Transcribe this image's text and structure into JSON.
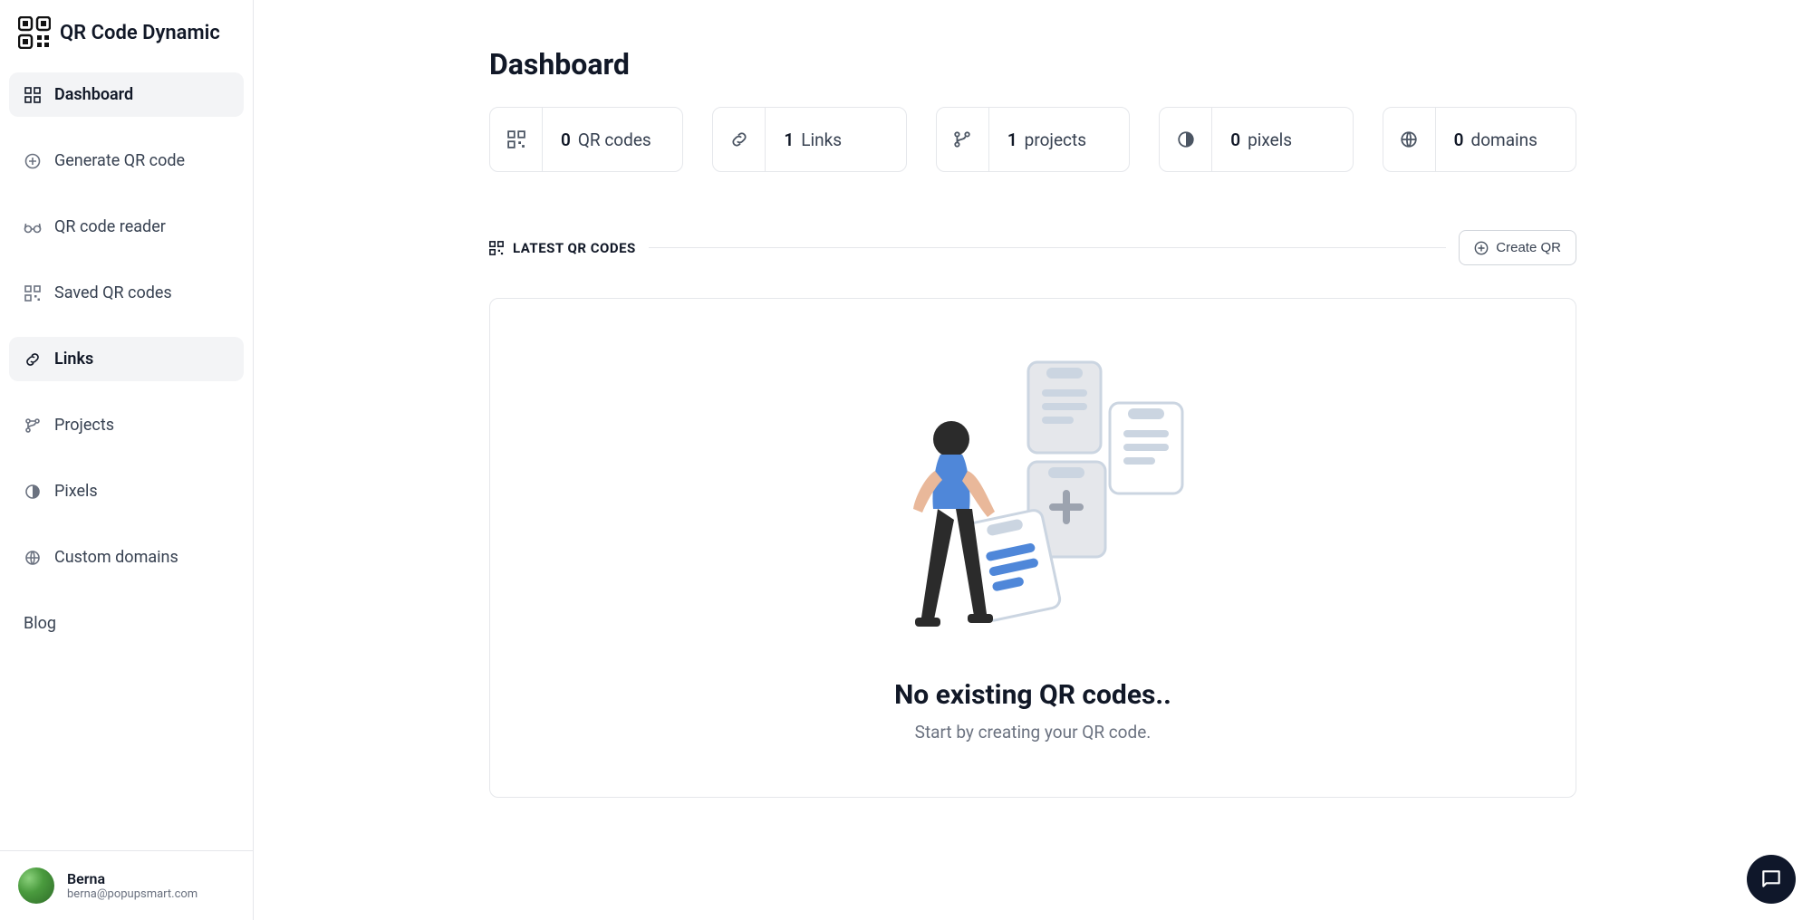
{
  "logo_text": "QR Code Dynamic",
  "sidebar": {
    "items": [
      {
        "label": "Dashboard",
        "icon": "grid"
      },
      {
        "label": "Generate QR code",
        "icon": "plus-circle"
      },
      {
        "label": "QR code reader",
        "icon": "glasses"
      },
      {
        "label": "Saved QR codes",
        "icon": "qr"
      },
      {
        "label": "Links",
        "icon": "link"
      },
      {
        "label": "Projects",
        "icon": "branch"
      },
      {
        "label": "Pixels",
        "icon": "contrast"
      },
      {
        "label": "Custom domains",
        "icon": "globe"
      },
      {
        "label": "Blog",
        "icon": ""
      }
    ],
    "active_index": 4
  },
  "user": {
    "name": "Berna",
    "email": "berna@popupsmart.com"
  },
  "page": {
    "title": "Dashboard",
    "stats": [
      {
        "value": "0",
        "label": "QR codes",
        "icon": "qr"
      },
      {
        "value": "1",
        "label": "Links",
        "icon": "link"
      },
      {
        "value": "1",
        "label": "projects",
        "icon": "branch"
      },
      {
        "value": "0",
        "label": "pixels",
        "icon": "contrast"
      },
      {
        "value": "0",
        "label": "domains",
        "icon": "globe"
      }
    ],
    "section_title": "LATEST QR CODES",
    "create_button": "Create QR",
    "empty": {
      "title": "No existing QR codes..",
      "subtitle": "Start by creating your QR code."
    }
  }
}
